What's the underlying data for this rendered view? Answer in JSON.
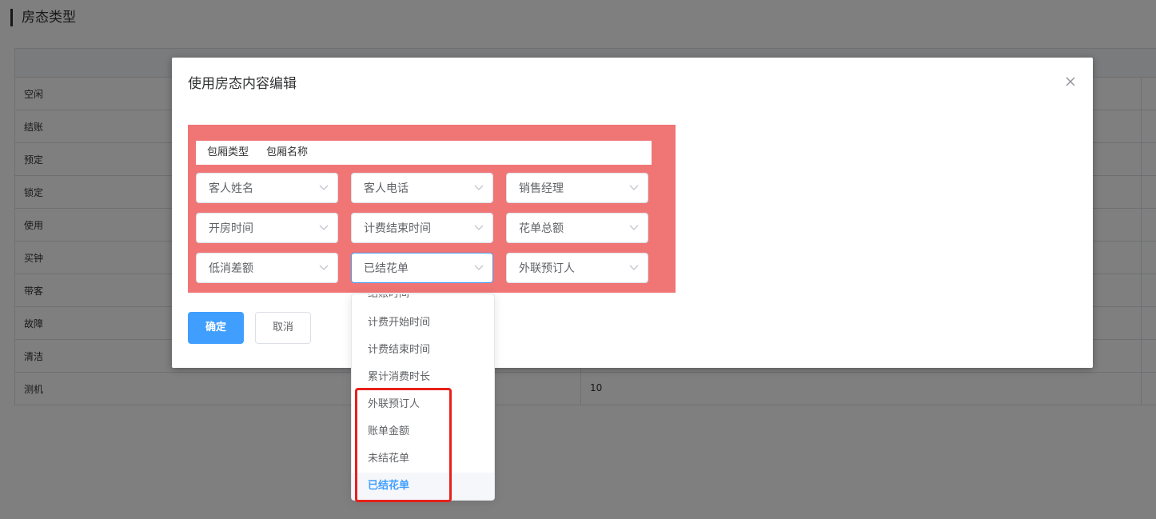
{
  "page": {
    "title": "房态类型",
    "rows": [
      {
        "name": "空闲",
        "value": ""
      },
      {
        "name": "结账",
        "value": ""
      },
      {
        "name": "预定",
        "value": ""
      },
      {
        "name": "锁定",
        "value": ""
      },
      {
        "name": "使用",
        "value": ""
      },
      {
        "name": "买钟",
        "value": ""
      },
      {
        "name": "带客",
        "value": ""
      },
      {
        "name": "故障",
        "value": ""
      },
      {
        "name": "清洁",
        "value": ""
      },
      {
        "name": "测机",
        "value": "10"
      }
    ]
  },
  "dialog": {
    "title": "使用房态内容编辑",
    "name_bar": {
      "room_type": "包厢类型",
      "room_name": "包厢名称"
    },
    "selects": [
      "客人姓名",
      "客人电话",
      "销售经理",
      "开房时间",
      "计费结束时间",
      "花单总额",
      "低消差额",
      "已结花单",
      "外联预订人"
    ],
    "confirm_label": "确定",
    "cancel_label": "取消"
  },
  "dropdown": {
    "options": [
      "结账时间",
      "计费开始时间",
      "计费结束时间",
      "累计消费时长",
      "外联预订人",
      "账单金额",
      "未结花单",
      "已结花单"
    ],
    "selected": "已结花单"
  },
  "colors": {
    "panel_red": "#f07575",
    "primary": "#409eff",
    "highlight": "#e8201b"
  }
}
